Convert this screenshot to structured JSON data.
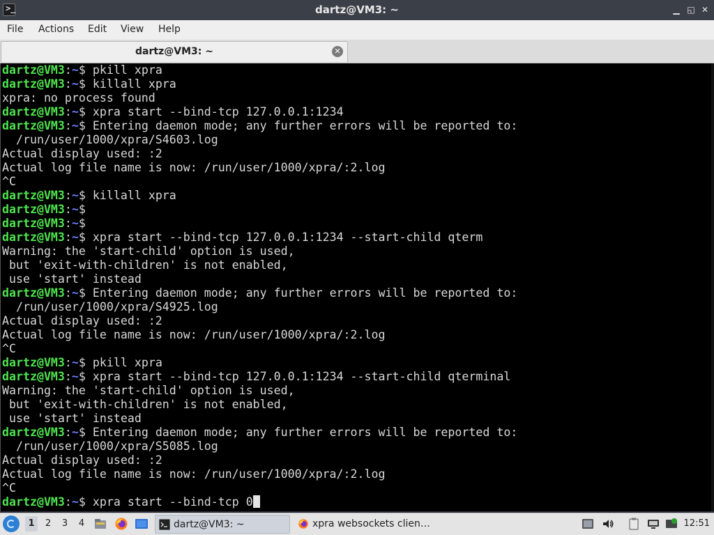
{
  "window": {
    "title": "dartz@VM3: ~",
    "controls": [
      "minimize",
      "maximize",
      "close"
    ]
  },
  "menu": [
    "File",
    "Actions",
    "Edit",
    "View",
    "Help"
  ],
  "tab": {
    "label": "dartz@VM3: ~"
  },
  "terminal": {
    "prompt_user": "dartz@VM3",
    "prompt_path": "~",
    "lines": [
      {
        "type": "cmd",
        "text": "pkill xpra"
      },
      {
        "type": "cmd",
        "text": "killall xpra"
      },
      {
        "type": "out",
        "text": "xpra: no process found"
      },
      {
        "type": "cmd",
        "text": "xpra start --bind-tcp 127.0.0.1:1234"
      },
      {
        "type": "cmd",
        "text": "Entering daemon mode; any further errors will be reported to:"
      },
      {
        "type": "out",
        "text": "  /run/user/1000/xpra/S4603.log"
      },
      {
        "type": "out",
        "text": "Actual display used: :2"
      },
      {
        "type": "out",
        "text": "Actual log file name is now: /run/user/1000/xpra/:2.log"
      },
      {
        "type": "out",
        "text": "^C"
      },
      {
        "type": "cmd",
        "text": "killall xpra"
      },
      {
        "type": "cmd",
        "text": ""
      },
      {
        "type": "cmd",
        "text": ""
      },
      {
        "type": "cmd",
        "text": "xpra start --bind-tcp 127.0.0.1:1234 --start-child qterm"
      },
      {
        "type": "out",
        "text": "Warning: the 'start-child' option is used,"
      },
      {
        "type": "out",
        "text": " but 'exit-with-children' is not enabled,"
      },
      {
        "type": "out",
        "text": " use 'start' instead"
      },
      {
        "type": "cmd",
        "text": "Entering daemon mode; any further errors will be reported to:"
      },
      {
        "type": "out",
        "text": "  /run/user/1000/xpra/S4925.log"
      },
      {
        "type": "out",
        "text": "Actual display used: :2"
      },
      {
        "type": "out",
        "text": "Actual log file name is now: /run/user/1000/xpra/:2.log"
      },
      {
        "type": "out",
        "text": "^C"
      },
      {
        "type": "cmd",
        "text": "pkill xpra"
      },
      {
        "type": "cmd",
        "text": "xpra start --bind-tcp 127.0.0.1:1234 --start-child qterminal"
      },
      {
        "type": "out",
        "text": "Warning: the 'start-child' option is used,"
      },
      {
        "type": "out",
        "text": " but 'exit-with-children' is not enabled,"
      },
      {
        "type": "out",
        "text": " use 'start' instead"
      },
      {
        "type": "cmd",
        "text": "Entering daemon mode; any further errors will be reported to:"
      },
      {
        "type": "out",
        "text": "  /run/user/1000/xpra/S5085.log"
      },
      {
        "type": "out",
        "text": "Actual display used: :2"
      },
      {
        "type": "out",
        "text": "Actual log file name is now: /run/user/1000/xpra/:2.log"
      },
      {
        "type": "out",
        "text": "^C"
      },
      {
        "type": "input",
        "text": "xpra start --bind-tcp 0"
      }
    ]
  },
  "taskbar": {
    "desktops": [
      "1",
      "2",
      "3",
      "4"
    ],
    "active_desktop": "1",
    "quicklaunch": [
      "file-manager-icon",
      "firefox-icon",
      "show-desktop-icon"
    ],
    "tasks": [
      {
        "label": "dartz@VM3: ~",
        "icon": "terminal-icon",
        "active": true
      },
      {
        "label": "xpra websockets clien…",
        "icon": "firefox-icon",
        "active": false
      }
    ],
    "tray": [
      "screenshot-icon",
      "volume-icon",
      "clipboard-icon",
      "network-icon",
      "update-icon"
    ],
    "clock": "12:51"
  },
  "colors": {
    "prompt_user": "#4fe44f",
    "prompt_path": "#6b7cff",
    "terminal_bg": "#000000",
    "terminal_fg": "#d8d8d8",
    "titlebar_bg": "#3b3f47"
  }
}
